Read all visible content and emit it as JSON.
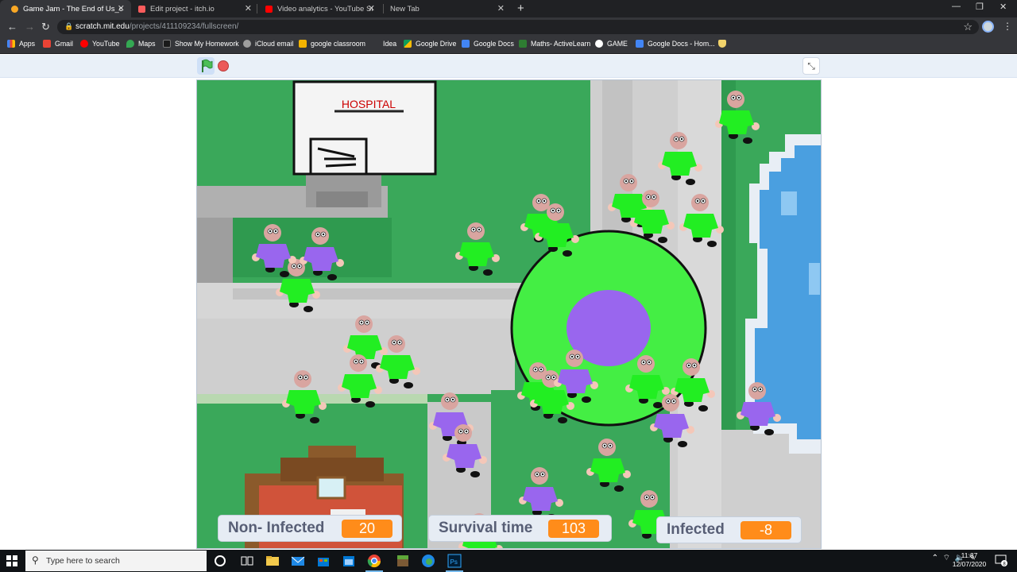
{
  "browser": {
    "tabs": [
      {
        "title": "Game Jam - The End of Us_on Scratch",
        "active": true,
        "favicon_color": "#f9a825"
      },
      {
        "title": "Edit project - itch.io",
        "active": false,
        "favicon_color": "#fa5c5c"
      },
      {
        "title": "Video analytics - YouTube Studio",
        "active": false,
        "favicon_color": "#ff0000"
      },
      {
        "title": "New Tab",
        "active": false,
        "favicon_color": "#35363a"
      }
    ],
    "new_tab_glyph": "+",
    "window_controls": [
      "—",
      "❐",
      "✕"
    ],
    "url_host": "scratch.mit.edu",
    "url_path": "/projects/411109234/fullscreen/",
    "bookmarks": [
      {
        "label": "Apps",
        "color": "#4285f4"
      },
      {
        "label": "Gmail",
        "color": "#ea4335"
      },
      {
        "label": "YouTube",
        "color": "#ff0000"
      },
      {
        "label": "Maps",
        "color": "#34a853"
      },
      {
        "label": "Show My Homework",
        "color": "#1a1a1a"
      },
      {
        "label": "iCloud email",
        "color": "#9e9e9e"
      },
      {
        "label": "google classroom",
        "color": "#f4b400"
      },
      {
        "label": "Idea",
        "color": "#35363a"
      },
      {
        "label": "Google Drive",
        "color": "#0f9d58"
      },
      {
        "label": "Google Docs",
        "color": "#4285f4"
      },
      {
        "label": "Maths- ActiveLearn",
        "color": "#2e7d32"
      },
      {
        "label": "GAME",
        "color": "#ffffff"
      },
      {
        "label": "Google Docs - Hom...",
        "color": "#4285f4"
      }
    ]
  },
  "scratch": {
    "hospital_sign": "HOSPITAL",
    "monitors": [
      {
        "label": "Non- Infected",
        "value": "20"
      },
      {
        "label": "Survival time",
        "value": "103"
      },
      {
        "label": "Infected",
        "value": "-8"
      }
    ],
    "colors": {
      "grass": "#3aa85a",
      "road": "#cfcfcf",
      "healthy": "#22ee22",
      "infected": "#9966ee",
      "water": "#4a9fe0",
      "monitor_value": "#ff8c1a"
    }
  },
  "taskbar": {
    "search_placeholder": "Type here to search",
    "time": "11:37",
    "date": "12/07/2020",
    "notification_count": "8"
  }
}
